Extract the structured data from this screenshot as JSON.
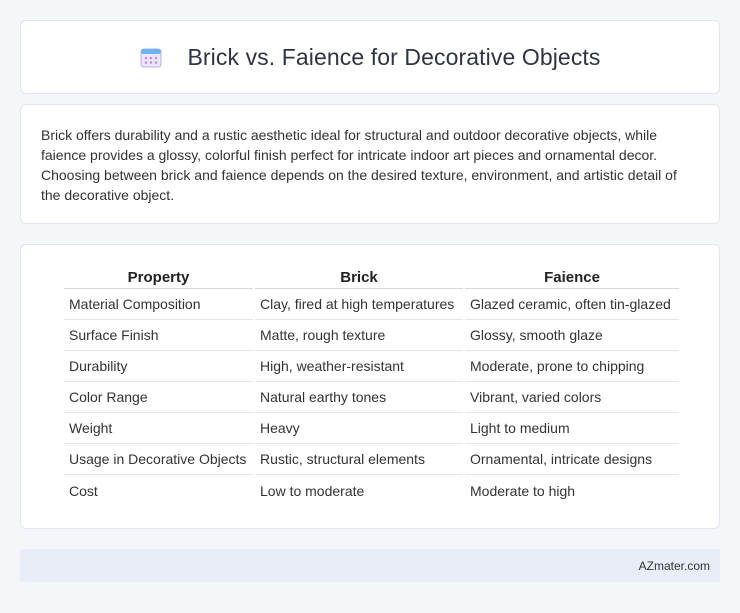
{
  "header": {
    "title": "Brick vs. Faience for Decorative Objects",
    "icon": "calendar-icon"
  },
  "summary": {
    "text": "Brick offers durability and a rustic aesthetic ideal for structural and outdoor decorative objects, while faience provides a glossy, colorful finish perfect for intricate indoor art pieces and ornamental decor. Choosing between brick and faience depends on the desired texture, environment, and artistic detail of the decorative object."
  },
  "table": {
    "headers": [
      "Property",
      "Brick",
      "Faience"
    ],
    "rows": [
      [
        "Material Composition",
        "Clay, fired at high temperatures",
        "Glazed ceramic, often tin-glazed"
      ],
      [
        "Surface Finish",
        "Matte, rough texture",
        "Glossy, smooth glaze"
      ],
      [
        "Durability",
        "High, weather-resistant",
        "Moderate, prone to chipping"
      ],
      [
        "Color Range",
        "Natural earthy tones",
        "Vibrant, varied colors"
      ],
      [
        "Weight",
        "Heavy",
        "Light to medium"
      ],
      [
        "Usage in Decorative Objects",
        "Rustic, structural elements",
        "Ornamental, intricate designs"
      ],
      [
        "Cost",
        "Low to moderate",
        "Moderate to high"
      ]
    ]
  },
  "footer": {
    "text": "AZmater.com"
  },
  "colors": {
    "background": "#f5f6fa",
    "card": "#ffffff",
    "footer_bar": "#e8edf7",
    "icon_accent": "#8a7fe0"
  }
}
